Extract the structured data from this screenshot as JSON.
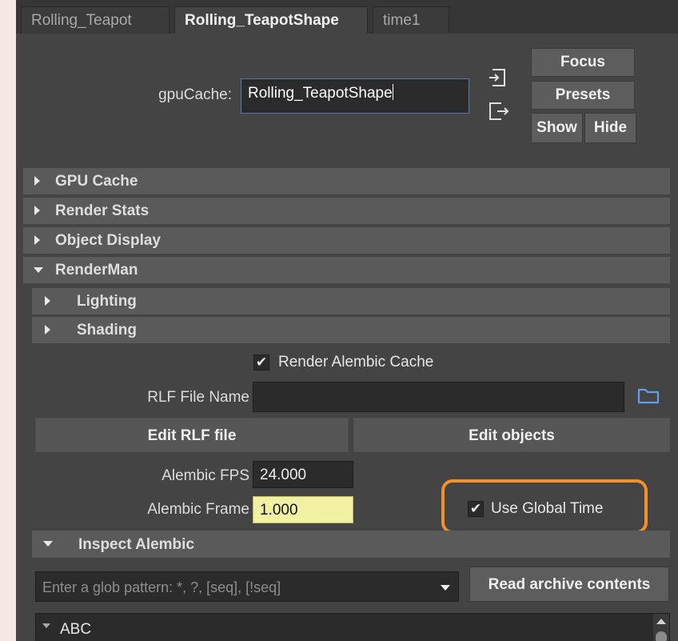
{
  "tabs": [
    {
      "label": "Rolling_Teapot",
      "active": false
    },
    {
      "label": "Rolling_TeapotShape",
      "active": true
    },
    {
      "label": "time1",
      "active": false
    }
  ],
  "node": {
    "label": "gpuCache:",
    "value": "Rolling_TeapotShape",
    "icons": [
      "input-connection-icon",
      "output-connection-icon"
    ]
  },
  "buttons": {
    "focus": "Focus",
    "presets": "Presets",
    "show": "Show",
    "hide": "Hide"
  },
  "sections": {
    "gpu_cache": "GPU Cache",
    "render_stats": "Render Stats",
    "object_display": "Object Display",
    "renderman": "RenderMan",
    "lighting": "Lighting",
    "shading": "Shading",
    "inspect_alembic": "Inspect Alembic"
  },
  "renderman": {
    "render_alembic_cache_label": "Render Alembic Cache",
    "render_alembic_cache_checked": true,
    "rlf_file_name_label": "RLF File Name",
    "rlf_file_name_value": "",
    "edit_rlf_label": "Edit RLF file",
    "edit_objects_label": "Edit objects",
    "alembic_fps_label": "Alembic FPS",
    "alembic_fps_value": "24.000",
    "alembic_frame_label": "Alembic Frame",
    "alembic_frame_value": "1.000",
    "use_global_time_label": "Use Global Time",
    "use_global_time_checked": true
  },
  "inspect": {
    "glob_placeholder": "Enter a glob pattern: *, ?, [seq], [!seq]",
    "read_archive_label": "Read archive contents",
    "tree_root": "ABC"
  },
  "colors": {
    "highlight": "#f0912b",
    "keyed_field": "#f2f0a2",
    "folder_icon": "#5f9fe6"
  }
}
